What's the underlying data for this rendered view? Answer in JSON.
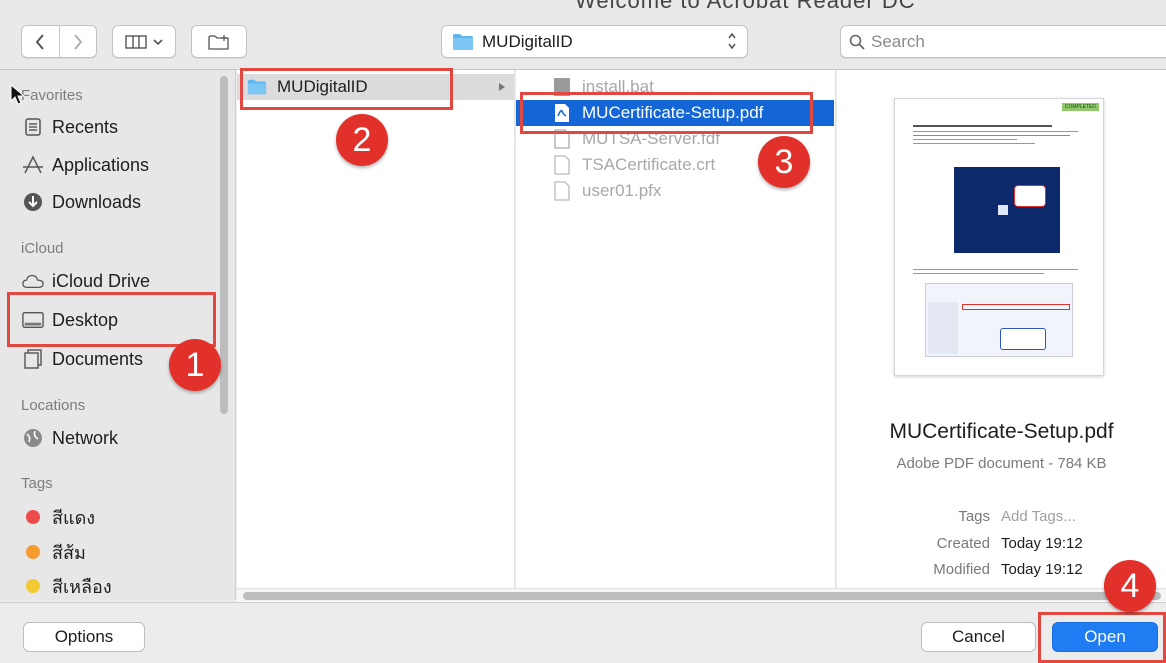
{
  "window": {
    "background_title": "Welcome to Acrobat Reader DC"
  },
  "toolbar": {
    "location": "MUDigitalID",
    "search_placeholder": "Search"
  },
  "sidebar": {
    "sections": [
      {
        "heading": "Favorites",
        "items": [
          {
            "label": "Recents",
            "icon": "clock-icon"
          },
          {
            "label": "Applications",
            "icon": "applications-icon"
          },
          {
            "label": "Downloads",
            "icon": "download-icon"
          }
        ]
      },
      {
        "heading": "iCloud",
        "items": [
          {
            "label": "iCloud Drive",
            "icon": "cloud-icon"
          },
          {
            "label": "Desktop",
            "icon": "desktop-icon",
            "selected": true
          },
          {
            "label": "Documents",
            "icon": "documents-icon"
          }
        ]
      },
      {
        "heading": "Locations",
        "items": [
          {
            "label": "Network",
            "icon": "network-icon"
          }
        ]
      },
      {
        "heading": "Tags",
        "items": [
          {
            "label": "สีแดง",
            "color": "#ee4b4b"
          },
          {
            "label": "สีส้ม",
            "color": "#f59b2d"
          },
          {
            "label": "สีเหลือง",
            "color": "#f3c934"
          }
        ]
      }
    ]
  },
  "columns": {
    "col1": [
      {
        "label": "MUDigitalID",
        "icon": "folder-icon",
        "selected": true
      }
    ],
    "col2": [
      {
        "label": "install.bat",
        "icon": "script-icon",
        "dim": true
      },
      {
        "label": "MUCertificate-Setup.pdf",
        "icon": "pdf-icon",
        "selected": true
      },
      {
        "label": "MUTSA-Server.fdf",
        "icon": "fdf-icon",
        "dim": true
      },
      {
        "label": "TSACertificate.crt",
        "icon": "file-icon",
        "dim": true
      },
      {
        "label": "user01.pfx",
        "icon": "file-icon",
        "dim": true
      }
    ]
  },
  "preview": {
    "name": "MUCertificate-Setup.pdf",
    "kind": "Adobe PDF document - 784 KB",
    "tags_key": "Tags",
    "tags_value": "Add Tags...",
    "created_key": "Created",
    "created_value": "Today 19:12",
    "modified_key": "Modified",
    "modified_value": "Today 19:12",
    "thumb_badge": "COMPLETED"
  },
  "buttons": {
    "options": "Options",
    "cancel": "Cancel",
    "open": "Open"
  },
  "annotations": {
    "step1": "1",
    "step2": "2",
    "step3": "3",
    "step4": "4"
  },
  "colors": {
    "accent": "#1466d6",
    "annotation": "#e2312b"
  }
}
